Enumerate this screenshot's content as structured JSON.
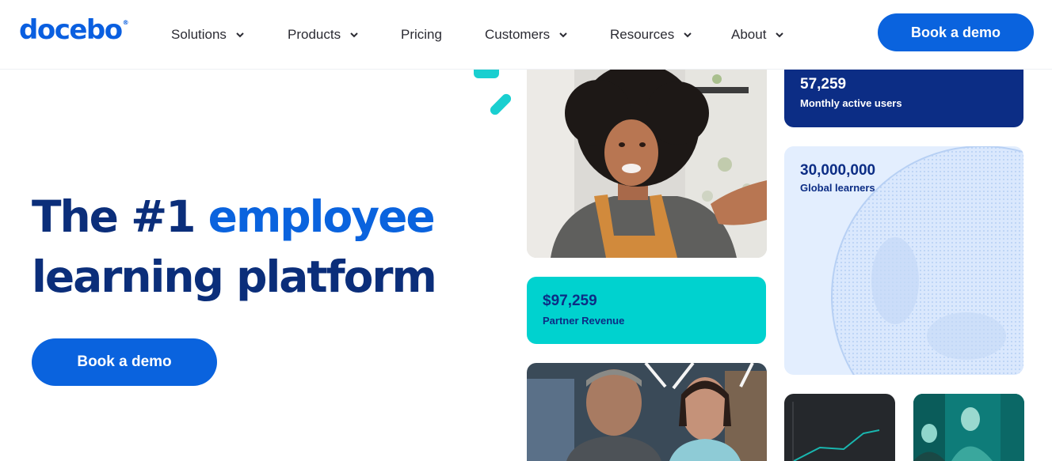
{
  "header": {
    "logo": "docebo",
    "logo_mark": "®",
    "nav": [
      {
        "label": "Solutions",
        "has_menu": true
      },
      {
        "label": "Products",
        "has_menu": true
      },
      {
        "label": "Pricing",
        "has_menu": false
      },
      {
        "label": "Customers",
        "has_menu": true
      },
      {
        "label": "Resources",
        "has_menu": true
      },
      {
        "label": "About",
        "has_menu": true
      }
    ],
    "cta_label": "Book a demo"
  },
  "hero": {
    "title_part1": "The #1",
    "title_accent": "employee",
    "title_line2": "learning platform",
    "cta_label": "Book a demo"
  },
  "stats": {
    "monthly_users": {
      "value": "57,259",
      "label": "Monthly active users"
    },
    "global_learners": {
      "value": "30,000,000",
      "label": "Global learners"
    },
    "partner_revenue": {
      "value": "$97,259",
      "label": "Partner Revenue"
    }
  },
  "colors": {
    "brand_blue": "#0a63de",
    "navy": "#0b2e7a",
    "teal": "#19cfd0",
    "light_blue": "#e3eefe"
  }
}
